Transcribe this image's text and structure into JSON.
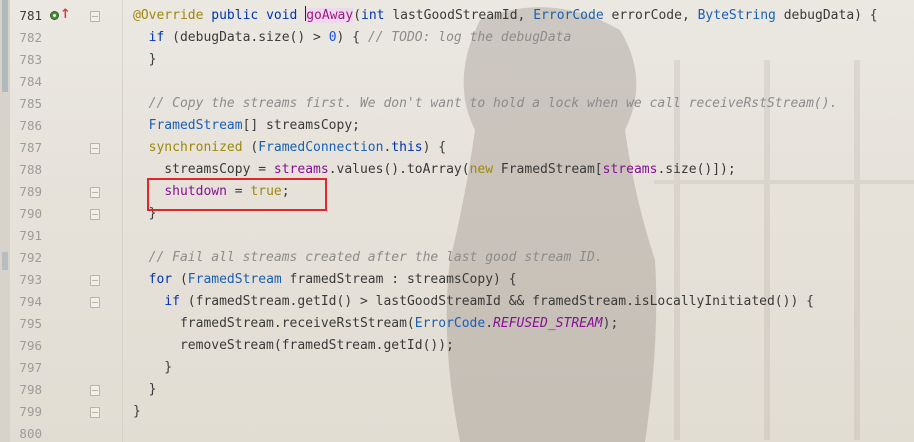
{
  "editor": {
    "lines": [
      {
        "num": "781",
        "segments": [
          {
            "t": "@Override",
            "c": "ann"
          },
          {
            "t": " ",
            "c": ""
          },
          {
            "t": "public",
            "c": "kw"
          },
          {
            "t": " ",
            "c": ""
          },
          {
            "t": "void",
            "c": "kw"
          },
          {
            "t": " ",
            "c": ""
          },
          {
            "t": "goAway",
            "c": "hl"
          },
          {
            "t": "(",
            "c": ""
          },
          {
            "t": "int",
            "c": "kw"
          },
          {
            "t": " lastGoodStreamId, ",
            "c": ""
          },
          {
            "t": "ErrorCode",
            "c": "type"
          },
          {
            "t": " errorCode, ",
            "c": ""
          },
          {
            "t": "ByteString",
            "c": "type"
          },
          {
            "t": " debugData) {",
            "c": ""
          }
        ]
      },
      {
        "num": "782",
        "segments": [
          {
            "t": "  ",
            "c": ""
          },
          {
            "t": "if",
            "c": "kw"
          },
          {
            "t": " (debugData.size() > ",
            "c": ""
          },
          {
            "t": "0",
            "c": "num"
          },
          {
            "t": ") { ",
            "c": ""
          },
          {
            "t": "// TODO: log the debugData",
            "c": "cmt"
          }
        ]
      },
      {
        "num": "783",
        "segments": [
          {
            "t": "  }",
            "c": ""
          }
        ]
      },
      {
        "num": "784",
        "segments": []
      },
      {
        "num": "785",
        "segments": [
          {
            "t": "  ",
            "c": ""
          },
          {
            "t": "// Copy the streams first. We don't want to hold a lock when we call receiveRstStream().",
            "c": "cmt"
          }
        ]
      },
      {
        "num": "786",
        "segments": [
          {
            "t": "  ",
            "c": ""
          },
          {
            "t": "FramedStream",
            "c": "type"
          },
          {
            "t": "[] streamsCopy;",
            "c": ""
          }
        ]
      },
      {
        "num": "787",
        "segments": [
          {
            "t": "  ",
            "c": ""
          },
          {
            "t": "synchronized",
            "c": "ann"
          },
          {
            "t": " (",
            "c": ""
          },
          {
            "t": "FramedConnection",
            "c": "type"
          },
          {
            "t": ".",
            "c": ""
          },
          {
            "t": "this",
            "c": "kw"
          },
          {
            "t": ") {",
            "c": ""
          }
        ]
      },
      {
        "num": "788",
        "segments": [
          {
            "t": "    streamsCopy = ",
            "c": ""
          },
          {
            "t": "streams",
            "c": "fld"
          },
          {
            "t": ".values().toArray(",
            "c": ""
          },
          {
            "t": "new",
            "c": "ann"
          },
          {
            "t": " FramedStream[",
            "c": ""
          },
          {
            "t": "streams",
            "c": "fld"
          },
          {
            "t": ".size()]);",
            "c": ""
          }
        ]
      },
      {
        "num": "789",
        "segments": [
          {
            "t": "    ",
            "c": ""
          },
          {
            "t": "shutdown",
            "c": "fld"
          },
          {
            "t": " = ",
            "c": ""
          },
          {
            "t": "true",
            "c": "ann"
          },
          {
            "t": ";",
            "c": ""
          }
        ]
      },
      {
        "num": "790",
        "segments": [
          {
            "t": "  }",
            "c": ""
          }
        ]
      },
      {
        "num": "791",
        "segments": []
      },
      {
        "num": "792",
        "segments": [
          {
            "t": "  ",
            "c": ""
          },
          {
            "t": "// Fail all streams created after the last good stream ID.",
            "c": "cmt"
          }
        ]
      },
      {
        "num": "793",
        "segments": [
          {
            "t": "  ",
            "c": ""
          },
          {
            "t": "for",
            "c": "kw"
          },
          {
            "t": " (",
            "c": ""
          },
          {
            "t": "FramedStream",
            "c": "type"
          },
          {
            "t": " framedStream : streamsCopy) {",
            "c": ""
          }
        ]
      },
      {
        "num": "794",
        "segments": [
          {
            "t": "    ",
            "c": ""
          },
          {
            "t": "if",
            "c": "kw"
          },
          {
            "t": " (framedStream.getId() > lastGoodStreamId && framedStream.isLocallyInitiated()) {",
            "c": ""
          }
        ]
      },
      {
        "num": "795",
        "segments": [
          {
            "t": "      framedStream.receiveRstStream(",
            "c": ""
          },
          {
            "t": "ErrorCode",
            "c": "type"
          },
          {
            "t": ".",
            "c": ""
          },
          {
            "t": "REFUSED_STREAM",
            "c": "fldi"
          },
          {
            "t": ");",
            "c": ""
          }
        ]
      },
      {
        "num": "796",
        "segments": [
          {
            "t": "      removeStream(framedStream.getId());",
            "c": ""
          }
        ]
      },
      {
        "num": "797",
        "segments": [
          {
            "t": "    }",
            "c": ""
          }
        ]
      },
      {
        "num": "798",
        "segments": [
          {
            "t": "  }",
            "c": ""
          }
        ]
      },
      {
        "num": "799",
        "segments": [
          {
            "t": "}",
            "c": ""
          }
        ]
      },
      {
        "num": "800",
        "segments": []
      }
    ]
  }
}
